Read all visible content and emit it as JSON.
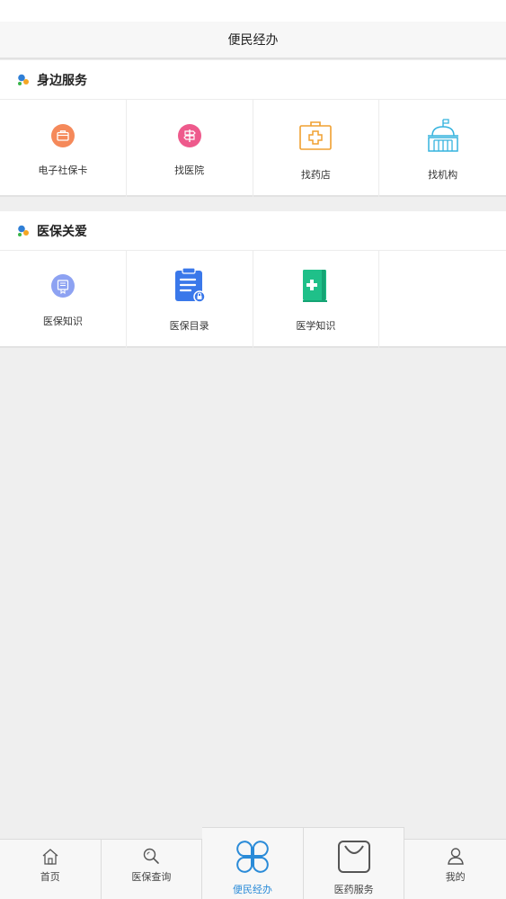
{
  "header": {
    "title": "便民经办"
  },
  "sections": [
    {
      "title": "身边服务",
      "items": [
        {
          "label": "电子社保卡",
          "icon": "briefcase-icon",
          "color": "#f5895a"
        },
        {
          "label": "找医院",
          "icon": "signpost-icon",
          "color": "#ee5a8c"
        },
        {
          "label": "找药店",
          "icon": "medical-kit-icon",
          "color": "#f0a030"
        },
        {
          "label": "找机构",
          "icon": "institution-building-icon",
          "color": "#35b3de"
        }
      ]
    },
    {
      "title": "医保关爱",
      "items": [
        {
          "label": "医保知识",
          "icon": "ribbon-card-icon",
          "color": "#8da2f2"
        },
        {
          "label": "医保目录",
          "icon": "clipboard-list-icon",
          "color": "#3a78ea"
        },
        {
          "label": "医学知识",
          "icon": "medical-book-icon",
          "color": "#1fc089"
        }
      ]
    }
  ],
  "tabbar": {
    "active_color": "#2a8bd8",
    "tabs": [
      {
        "label": "首页",
        "icon": "home-icon"
      },
      {
        "label": "医保查询",
        "icon": "search-icon"
      },
      {
        "label": "便民经办",
        "icon": "clover-icon"
      },
      {
        "label": "医药服务",
        "icon": "shopping-bag-icon"
      },
      {
        "label": "我的",
        "icon": "user-icon"
      }
    ]
  }
}
